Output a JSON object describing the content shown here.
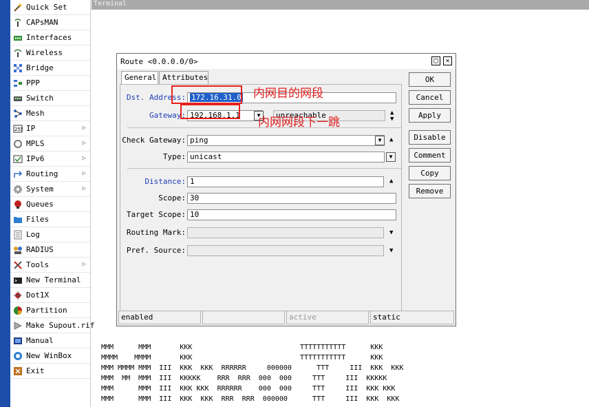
{
  "sidebar": {
    "items": [
      {
        "label": "Quick Set",
        "icon": "wand-icon",
        "submenu": false
      },
      {
        "label": "CAPsMAN",
        "icon": "antenna-icon",
        "submenu": false
      },
      {
        "label": "Interfaces",
        "icon": "interfaces-icon",
        "submenu": false
      },
      {
        "label": "Wireless",
        "icon": "wireless-icon",
        "submenu": false
      },
      {
        "label": "Bridge",
        "icon": "bridge-icon",
        "submenu": false
      },
      {
        "label": "PPP",
        "icon": "ppp-icon",
        "submenu": false
      },
      {
        "label": "Switch",
        "icon": "switch-icon",
        "submenu": false
      },
      {
        "label": "Mesh",
        "icon": "mesh-icon",
        "submenu": false
      },
      {
        "label": "IP",
        "icon": "ip-icon",
        "submenu": true
      },
      {
        "label": "MPLS",
        "icon": "mpls-icon",
        "submenu": true
      },
      {
        "label": "IPv6",
        "icon": "ipv6-icon",
        "submenu": true
      },
      {
        "label": "Routing",
        "icon": "routing-icon",
        "submenu": true
      },
      {
        "label": "System",
        "icon": "gear-icon",
        "submenu": true
      },
      {
        "label": "Queues",
        "icon": "queues-icon",
        "submenu": false
      },
      {
        "label": "Files",
        "icon": "folder-icon",
        "submenu": false
      },
      {
        "label": "Log",
        "icon": "log-icon",
        "submenu": false
      },
      {
        "label": "RADIUS",
        "icon": "radius-icon",
        "submenu": false
      },
      {
        "label": "Tools",
        "icon": "tools-icon",
        "submenu": true
      },
      {
        "label": "New Terminal",
        "icon": "terminal-icon",
        "submenu": false
      },
      {
        "label": "Dot1X",
        "icon": "dot1x-icon",
        "submenu": false
      },
      {
        "label": "Partition",
        "icon": "partition-icon",
        "submenu": false
      },
      {
        "label": "Make Supout.rif",
        "icon": "supout-icon",
        "submenu": false
      },
      {
        "label": "Manual",
        "icon": "manual-icon",
        "submenu": false
      },
      {
        "label": "New WinBox",
        "icon": "winbox-icon",
        "submenu": false
      },
      {
        "label": "Exit",
        "icon": "exit-icon",
        "submenu": false
      }
    ]
  },
  "terminal": {
    "title": "Terminal"
  },
  "dialog": {
    "title": "Route <0.0.0.0/0>",
    "tabs": [
      "General",
      "Attributes"
    ],
    "fields": {
      "dst_address": {
        "label": "Dst. Address:",
        "value": "172.16.31.0"
      },
      "gateway": {
        "label": "Gateway:",
        "value": "192.168.1.1",
        "status": "unreachable"
      },
      "check_gateway": {
        "label": "Check Gateway:",
        "value": "ping"
      },
      "type": {
        "label": "Type:",
        "value": "unicast"
      },
      "distance": {
        "label": "Distance:",
        "value": "1"
      },
      "scope": {
        "label": "Scope:",
        "value": "30"
      },
      "target_scope": {
        "label": "Target Scope:",
        "value": "10"
      },
      "routing_mark": {
        "label": "Routing Mark:",
        "value": ""
      },
      "pref_source": {
        "label": "Pref. Source:",
        "value": ""
      }
    },
    "buttons": [
      "OK",
      "Cancel",
      "Apply",
      "Disable",
      "Comment",
      "Copy",
      "Remove"
    ],
    "status": [
      "enabled",
      "",
      "active",
      "static"
    ]
  },
  "annotations": {
    "dst": "内网目的网段",
    "gateway": "内网网段下一跳"
  },
  "terminal_ascii": [
    "MMM      MMM       KKK                          TTTTTTTTTTT      KKK",
    "MMMM    MMMM       KKK                          TTTTTTTTTTT      KKK",
    "MMM MMMM MMM  III  KKK  KKK  RRRRRR     000000      TTT     III  KKK  KKK",
    "MMM  MM  MMM  III  KKKKK    RRR  RRR  000  000     TTT     III  KKKKK",
    "MMM      MMM  III  KKK KKK  RRRRRR    000  000     TTT     III  KKK KKK",
    "MMM      MMM  III  KKK  KKK  RRR  RRR  000000      TTT     III  KKK  KKK"
  ],
  "colors": {
    "left_strip": "#1d4ea8",
    "highlight_red": "#e8201c",
    "field_label_blue": "#1f3fb8"
  }
}
